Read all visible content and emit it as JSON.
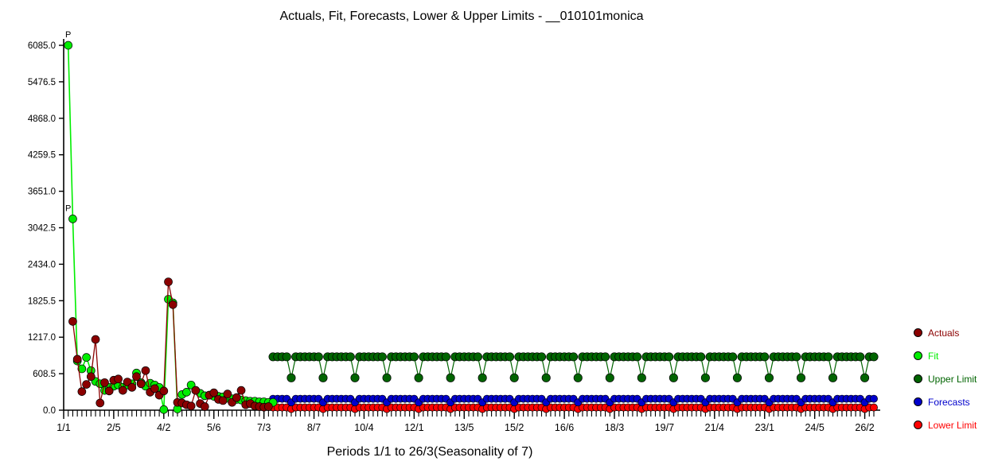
{
  "chart_data": {
    "type": "line",
    "title": "Actuals, Fit, Forecasts, Lower & Upper Limits - __010101monica",
    "xlabel": "Periods 1/1 to 26/3(Seasonality of 7)",
    "ylabel": "",
    "grid": false,
    "legend_position": "right",
    "ylim": [
      0.0,
      6085.0
    ],
    "ytick_labels": [
      "0.0",
      "608.5",
      "1217.0",
      "1825.5",
      "2434.0",
      "3042.5",
      "3651.0",
      "4259.5",
      "4868.0",
      "5476.5",
      "6085.0"
    ],
    "ytick_values": [
      0.0,
      608.5,
      1217.0,
      1825.5,
      2434.0,
      3042.5,
      3651.0,
      4259.5,
      4868.0,
      5476.5,
      6085.0
    ],
    "xtick_labels": [
      "1/1",
      "2/5",
      "4/2",
      "5/6",
      "7/3",
      "8/7",
      "10/4",
      "12/1",
      "13/5",
      "15/2",
      "16/6",
      "18/3",
      "19/7",
      "21/4",
      "23/1",
      "24/5",
      "26/2"
    ],
    "xtick_indices": [
      0,
      11,
      22,
      33,
      44,
      55,
      66,
      77,
      88,
      99,
      110,
      121,
      132,
      143,
      154,
      165,
      176
    ],
    "total_periods": 179,
    "annotations": [
      {
        "text": "P",
        "index": 1,
        "value": 6085.0
      },
      {
        "text": "P",
        "index": 1,
        "value": 3190.0
      }
    ],
    "series": [
      {
        "name": "Actuals",
        "color": "#8B0000",
        "x": [
          2,
          3,
          4,
          5,
          6,
          7,
          8,
          9,
          10,
          11,
          12,
          13,
          14,
          15,
          16,
          17,
          18,
          19,
          20,
          21,
          22,
          23,
          24,
          25,
          26,
          27,
          28,
          29,
          30,
          31,
          32,
          33,
          34,
          35,
          36,
          37,
          38,
          39,
          40,
          41,
          42,
          43,
          44,
          45
        ],
        "values": [
          1480,
          850,
          310,
          430,
          560,
          1180,
          120,
          460,
          320,
          500,
          520,
          330,
          470,
          380,
          560,
          440,
          660,
          300,
          360,
          250,
          320,
          2140,
          1760,
          130,
          120,
          90,
          70,
          330,
          110,
          60,
          250,
          290,
          180,
          160,
          270,
          130,
          210,
          330,
          90,
          110,
          70,
          60,
          50,
          60
        ]
      },
      {
        "name": "Fit",
        "color": "#00EE00",
        "x": [
          1,
          2,
          3,
          4,
          5,
          6,
          7,
          8,
          9,
          10,
          11,
          12,
          13,
          14,
          15,
          16,
          17,
          18,
          19,
          20,
          21,
          22,
          23,
          24,
          25,
          26,
          27,
          28,
          29,
          30,
          31,
          32,
          33,
          34,
          35,
          36,
          37,
          38,
          39,
          40,
          41,
          42,
          43,
          44,
          45,
          46
        ],
        "values": [
          6085,
          3190,
          820,
          690,
          880,
          660,
          480,
          440,
          330,
          380,
          400,
          420,
          380,
          420,
          440,
          620,
          460,
          400,
          450,
          420,
          380,
          10,
          1850,
          1790,
          20,
          260,
          300,
          420,
          330,
          280,
          240,
          250,
          230,
          230,
          220,
          200,
          190,
          180,
          170,
          160,
          150,
          150,
          140,
          140,
          130,
          130
        ]
      },
      {
        "name": "Upper Limit",
        "color": "#006400",
        "color_note": "dark green band with seasonal dips every 7 periods",
        "baseline": 890,
        "dip_value": 540,
        "dip_period": 7,
        "start_index": 46,
        "end_index": 178
      },
      {
        "name": "Forecasts",
        "color": "#0000CC",
        "baseline": 190,
        "dip_value": 130,
        "dip_period": 7,
        "start_index": 46,
        "end_index": 178
      },
      {
        "name": "Lower Limit",
        "color": "#FF0000",
        "baseline": 45,
        "dip_value": 20,
        "dip_period": 7,
        "start_index": 46,
        "end_index": 178
      }
    ]
  },
  "legend": {
    "items": [
      {
        "label": "Actuals",
        "color": "#8B0000"
      },
      {
        "label": "Fit",
        "color": "#00EE00"
      },
      {
        "label": "Upper Limit",
        "color": "#006400"
      },
      {
        "label": "Forecasts",
        "color": "#0000CC"
      },
      {
        "label": "Lower Limit",
        "color": "#FF0000"
      }
    ]
  }
}
